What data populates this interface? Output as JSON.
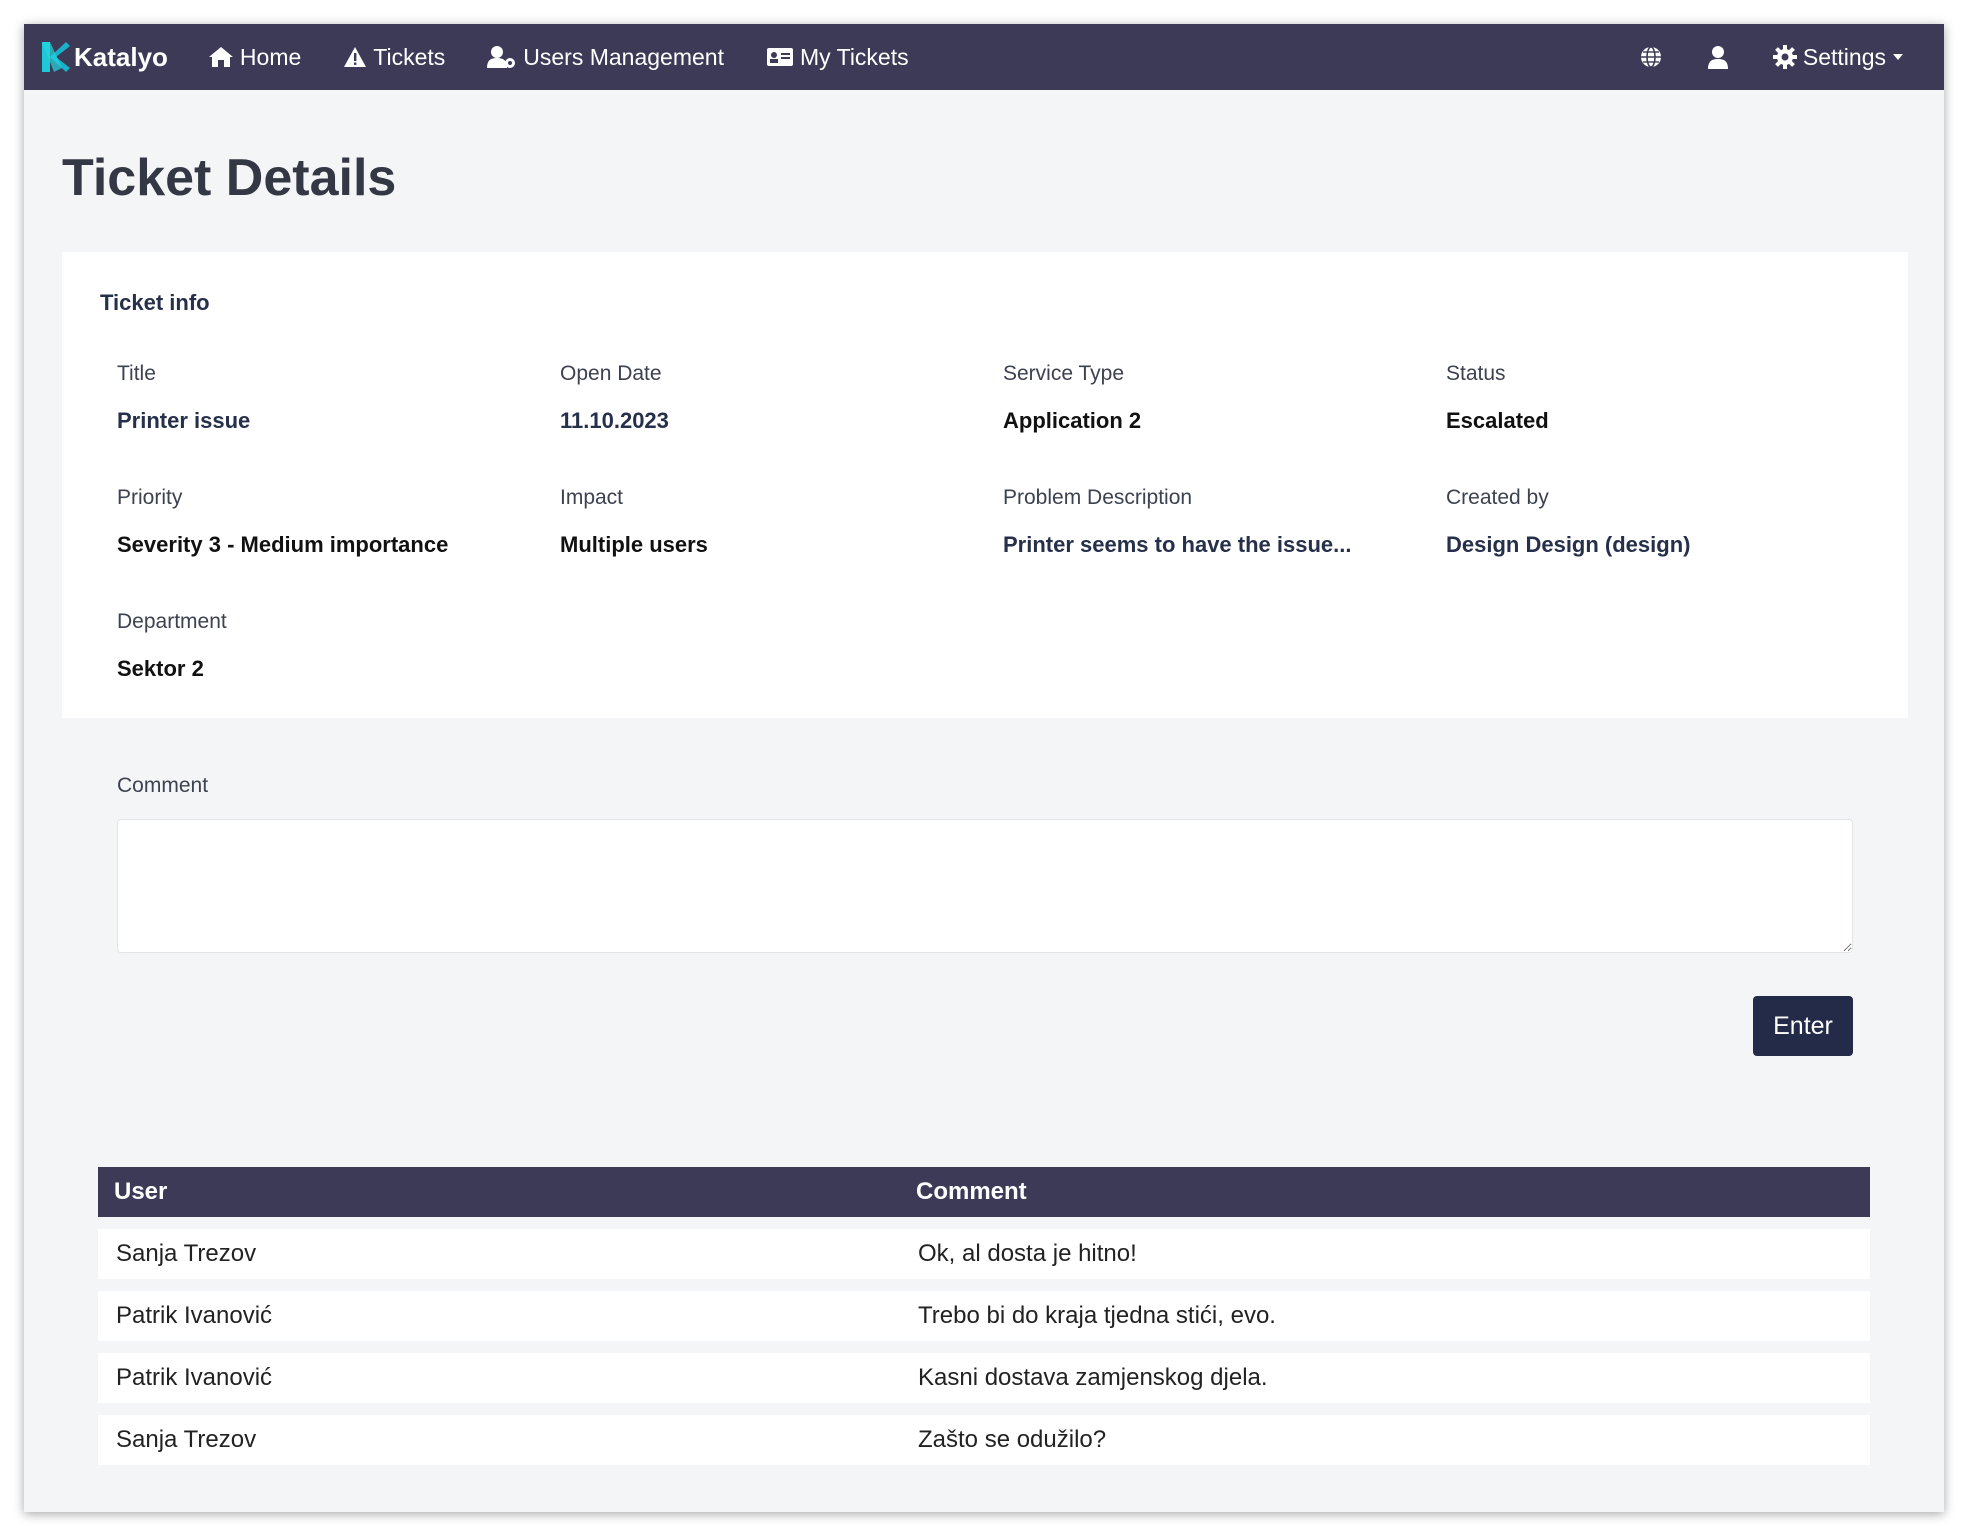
{
  "nav": {
    "brand": "Katalyo",
    "items": [
      {
        "label": "Home",
        "icon": "home-icon"
      },
      {
        "label": "Tickets",
        "icon": "warning-icon"
      },
      {
        "label": "Users Management",
        "icon": "user-cog-icon"
      },
      {
        "label": "My Tickets",
        "icon": "id-card-icon"
      }
    ],
    "settings_label": "Settings"
  },
  "page": {
    "title": "Ticket Details"
  },
  "ticket_info": {
    "heading": "Ticket info",
    "fields": [
      {
        "label": "Title",
        "value": "Printer issue"
      },
      {
        "label": "Open Date",
        "value": "11.10.2023"
      },
      {
        "label": "Service Type",
        "value": "Application 2"
      },
      {
        "label": "Status",
        "value": "Escalated"
      },
      {
        "label": "Priority",
        "value": "Severity 3 - Medium importance"
      },
      {
        "label": "Impact",
        "value": "Multiple users"
      },
      {
        "label": "Problem Description",
        "value": "Printer seems to have the issue..."
      },
      {
        "label": "Created by",
        "value": "Design Design (design)"
      },
      {
        "label": "Department",
        "value": "Sektor 2"
      }
    ]
  },
  "comment_form": {
    "label": "Comment",
    "value": "",
    "button_label": "Enter"
  },
  "comments_table": {
    "headers": [
      "User",
      "Comment"
    ],
    "rows": [
      [
        "Sanja Trezov",
        "Ok, al dosta je hitno!"
      ],
      [
        "Patrik Ivanović",
        "Trebo bi do kraja tjedna stići, evo."
      ],
      [
        "Patrik Ivanović",
        "Kasni dostava zamjenskog djela."
      ],
      [
        "Sanja Trezov",
        "Zašto se odužilo?"
      ]
    ]
  },
  "colors": {
    "navbar": "#3d3a57",
    "brand_accent": "#1ec8d6",
    "button": "#242b48",
    "page_bg": "#f4f5f7"
  }
}
